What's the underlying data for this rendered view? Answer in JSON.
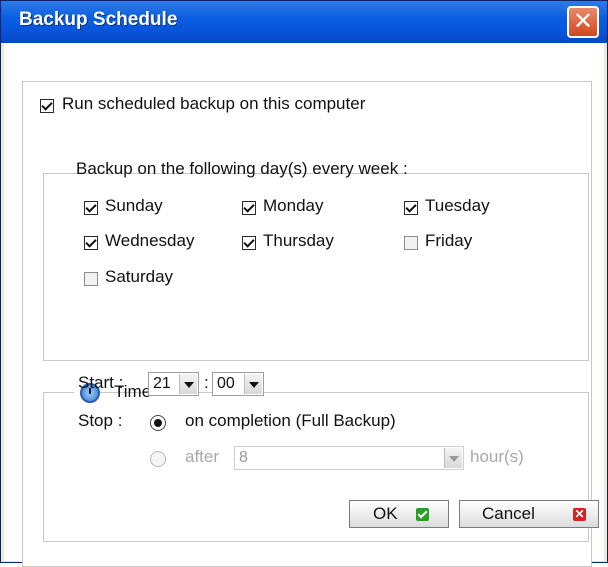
{
  "window": {
    "title": "Backup Schedule"
  },
  "run_scheduled": {
    "label": "Run scheduled backup on this computer",
    "checked": true
  },
  "days": {
    "heading": "Backup on the following day(s) every week :",
    "items": [
      {
        "label": "Sunday",
        "checked": true
      },
      {
        "label": "Monday",
        "checked": true
      },
      {
        "label": "Tuesday",
        "checked": true
      },
      {
        "label": "Wednesday",
        "checked": true
      },
      {
        "label": "Thursday",
        "checked": true
      },
      {
        "label": "Friday",
        "checked": false
      },
      {
        "label": "Saturday",
        "checked": false
      }
    ]
  },
  "time": {
    "legend": "Time",
    "start_label": "Start :",
    "start_hour": "21",
    "separator": ":",
    "start_minute": "00",
    "stop_label": "Stop :",
    "stop_option1": "on completion (Full Backup)",
    "stop_option2_label": "after",
    "stop_after_value": "8",
    "hours_label": "hour(s)"
  },
  "buttons": {
    "ok": "OK",
    "cancel": "Cancel"
  },
  "colors": {
    "titlebar": "#0855dc",
    "ok_icon": "#2e9b27",
    "cancel_icon": "#d32323"
  },
  "icons": {
    "close": "close-icon",
    "clock": "clock-icon",
    "ok": "ok-check-icon",
    "cancel": "cancel-x-icon"
  }
}
